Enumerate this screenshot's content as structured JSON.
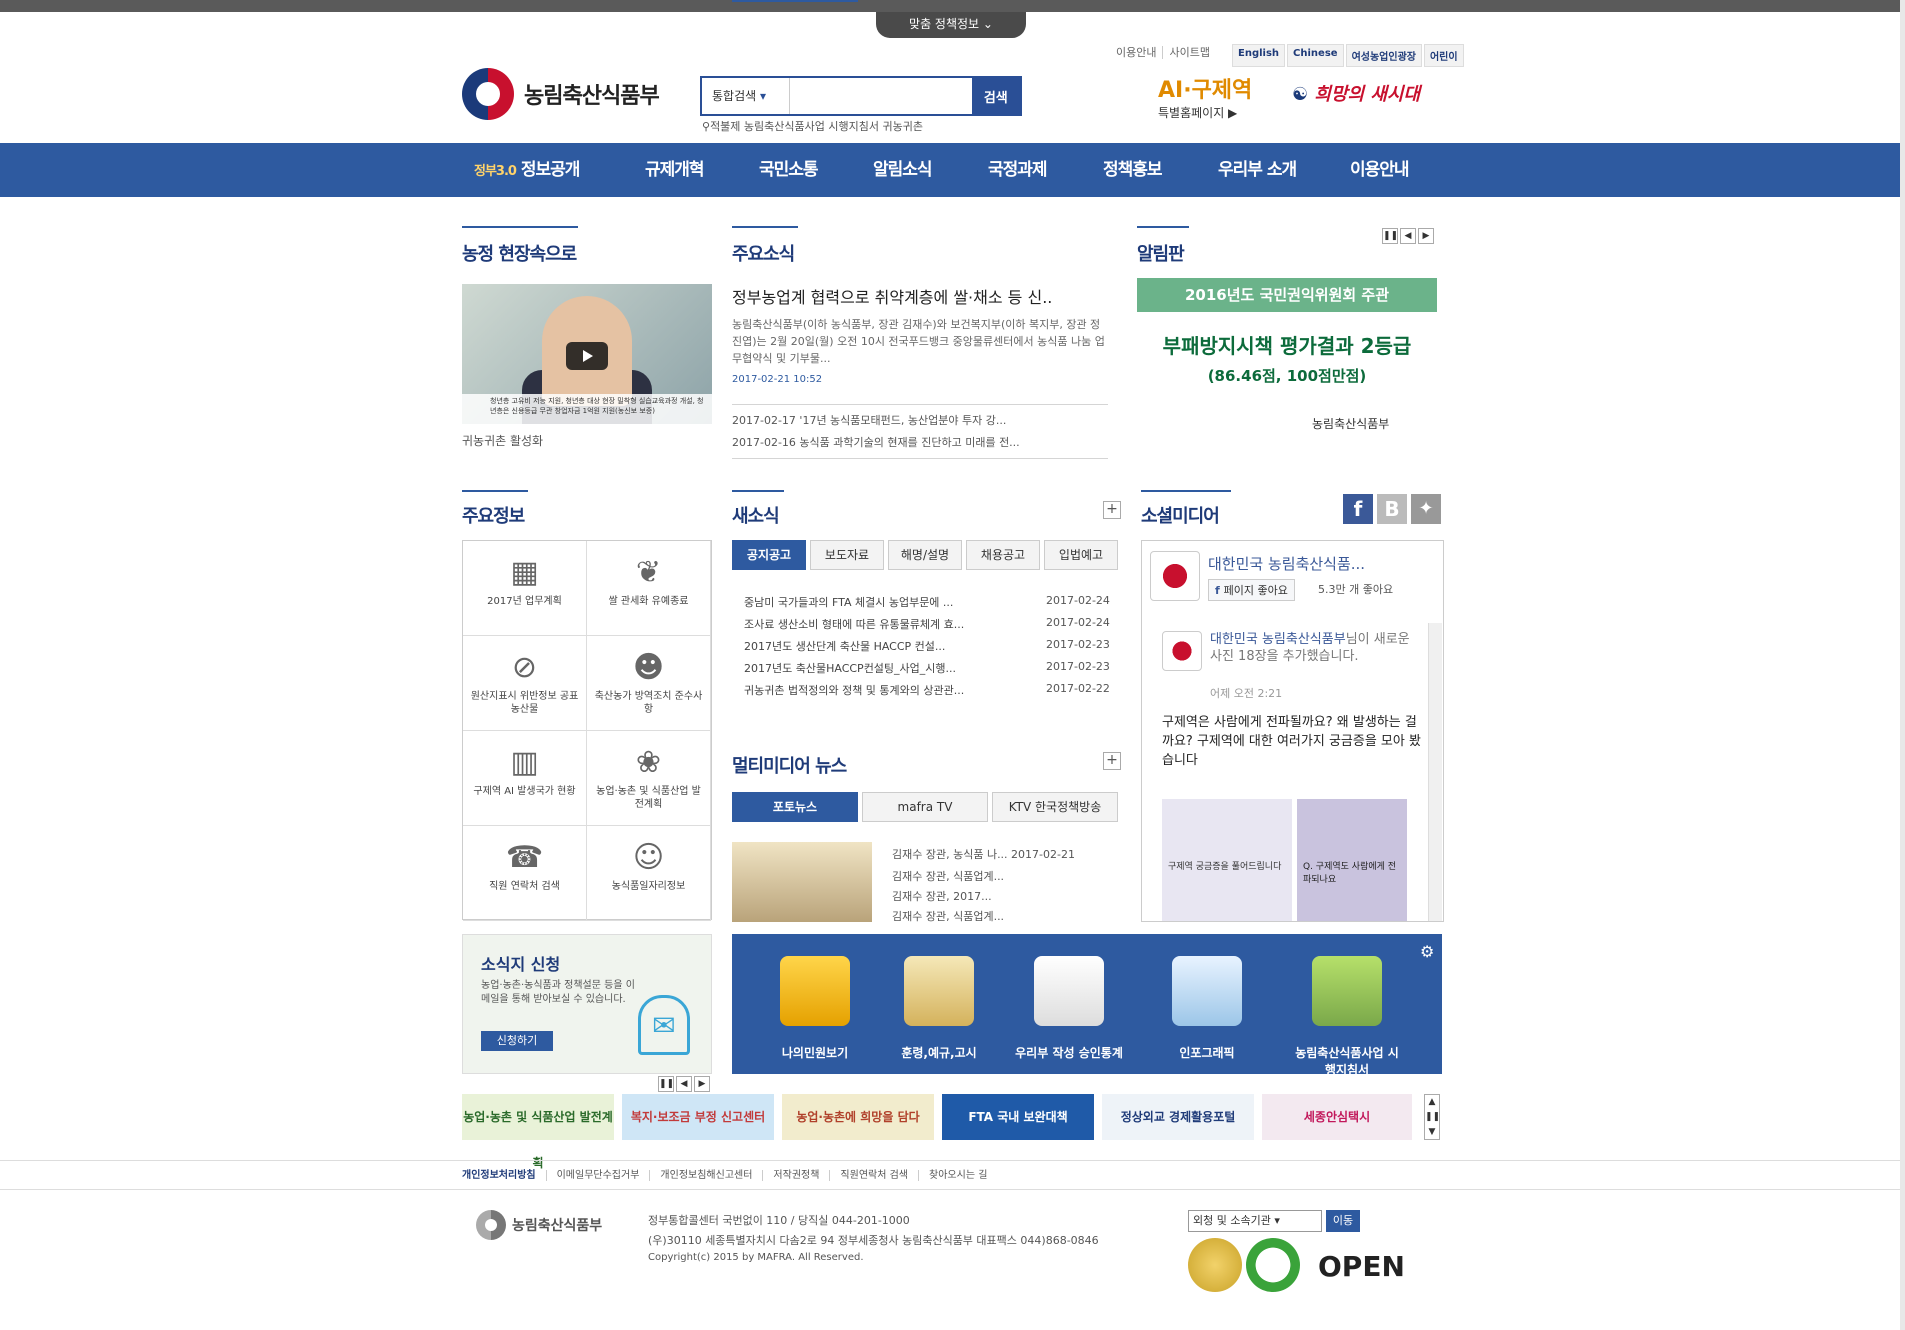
{
  "top": {
    "tab_label": "맞춤 정책정보",
    "links": [
      "이용안내",
      "사이트맵"
    ],
    "langs": [
      "English",
      "Chinese",
      "여성농업인광장",
      "어린이"
    ]
  },
  "header": {
    "org_name": "농림축산식품부",
    "search_scope": "통합검색",
    "search_button": "검색",
    "keywords": "적불제 농림축산식품사업 시행지침서 귀농귀촌",
    "ai_title": "AI·구제역",
    "ai_sub": "특별홈페이지 ▶",
    "slogan": "희망의 새시대"
  },
  "gnb": [
    "정보공개",
    "규제개혁",
    "국민소통",
    "알림소식",
    "국정과제",
    "정책홍보",
    "우리부 소개",
    "이용안내"
  ],
  "gov3": "정부3.0",
  "field": {
    "title": "농정 현장속으로",
    "caption": "귀농귀촌 활성화",
    "video_caption": "청년층 고유비 저능 지원, 청년층 대상 현장 밀착형 실습교육과정 개설, 청년층은 신용등급 무관 창업자금 1억원 지원(농신보 보증)"
  },
  "news": {
    "title": "주요소식",
    "headline": "정부농업계 협력으로 취약계층에 쌀·채소 등 신..",
    "body": "농림축산식품부(이하 농식품부, 장관 김재수)와 보건복지부(이하 복지부, 장관 정진엽)는 2월 20일(월) 오전 10시 전국푸드뱅크 중앙물류센터에서 농식품 나눔 업무협약식 및 기부물...",
    "date": "2017-02-21 10:52",
    "items": [
      "2017-02-17 '17년 농식품모태펀드, 농산업분야 투자 강...",
      "2017-02-16 농식품 과학기술의 현재를 진단하고 미래를 전..."
    ]
  },
  "board": {
    "title": "알림판",
    "bar": "2016년도 국민권익위원회 주관",
    "main": "부패방지시책 평가결과 2등급",
    "sub": "(86.46점, 100점만점)",
    "org": "농림축산식품부"
  },
  "info": {
    "title": "주요정보",
    "cells": [
      "2017년 업무계획",
      "쌀 관세화 유예종료",
      "원산지표시 위반정보 공표농산물",
      "축산농가 방역조치 준수사항",
      "구제역 AI 발생국가 현황",
      "농업·농촌 및 식품산업 발전계획",
      "직원 연락처 검색",
      "농식품일자리정보"
    ]
  },
  "notice": {
    "title": "새소식",
    "tabs": [
      "공지공고",
      "보도자료",
      "해명/설명",
      "채용공고",
      "입법예고"
    ],
    "rows": [
      {
        "t": "중남미 국가들과의 FTA 체결시 농업부문에 ...",
        "d": "2017-02-24"
      },
      {
        "t": "조사료 생산소비 형태에 따른 유통물류체계 효...",
        "d": "2017-02-24"
      },
      {
        "t": "2017년도 생산단계 축산물 HACCP 컨설...",
        "d": "2017-02-23"
      },
      {
        "t": "2017년도 축산물HACCP컨설팅_사업_시행...",
        "d": "2017-02-23"
      },
      {
        "t": "귀농귀촌 법적정의와 정책 및 통계와의 상관관...",
        "d": "2017-02-22"
      }
    ]
  },
  "multi": {
    "title": "멀티미디어 뉴스",
    "tabs": [
      "포토뉴스",
      "mafra TV",
      "KTV 한국정책방송"
    ],
    "items": [
      "김재수 장관, 농식품 나... 2017-02-21",
      "김재수 장관, 식품업계...",
      "김재수 장관, 2017...",
      "김재수 장관, 식품업계..."
    ]
  },
  "social": {
    "title": "소셜미디어",
    "page": "대한민국 농림축산식품...",
    "like": "페이지 좋아요",
    "likes": "5.3만 개 좋아요",
    "poster": "대한민국 농림축산식품부",
    "action": "님이 새로운 사진 18장을 추가했습니다.",
    "time": "어제 오전 2:21",
    "text": "구제역은 사람에게 전파될까요? 왜 발생하는 걸까요? 구제역에 대한 여러가지 궁금증을 모아 봤습니다",
    "img1": "구제역 궁금증을 풀어드립니다",
    "img2": "Q. 구제역도 사람에게 전파되나요"
  },
  "newsletter": {
    "title": "소식지 신청",
    "desc": "농업·농촌·농식품과 정책설문 등을 이메일을 통해 받아보실 수 있습니다.",
    "button": "신청하기"
  },
  "iconbar": [
    "나의민원보기",
    "훈령,예규,고시",
    "우리부 작성 승인통계",
    "인포그래픽",
    "농림축산식품사업 시행지침서"
  ],
  "banners": [
    "농업·농촌 및 식품산업 발전계획",
    "복지·보조금 부정 신고센터",
    "농업·농촌에 희망을 담다",
    "FTA 국내 보완대책",
    "정상외교 경제활용포털",
    "세종안심택시"
  ],
  "footer": {
    "nav": [
      "개인정보처리방침",
      "이메일무단수집거부",
      "개인정보침해신고센터",
      "저작권정책",
      "직원연락처 검색",
      "찾아오시는 길"
    ],
    "org": "농림축산식품부",
    "call": "정부통합콜센터 국번없이 110 / 당직실 044-201-1000",
    "addr": "(우)30110 세종특별자치시 다솜2로 94 정부세종청사 농림축산식품부   대표팩스 044)868-0846",
    "copy": "Copyright(c) 2015 by MAFRA. All Reserved.",
    "related": "외청 및 소속기관",
    "go": "이동",
    "open": "OPEN"
  },
  "colors": {
    "primary": "#2e5aa0",
    "green": "#6bb38a"
  }
}
